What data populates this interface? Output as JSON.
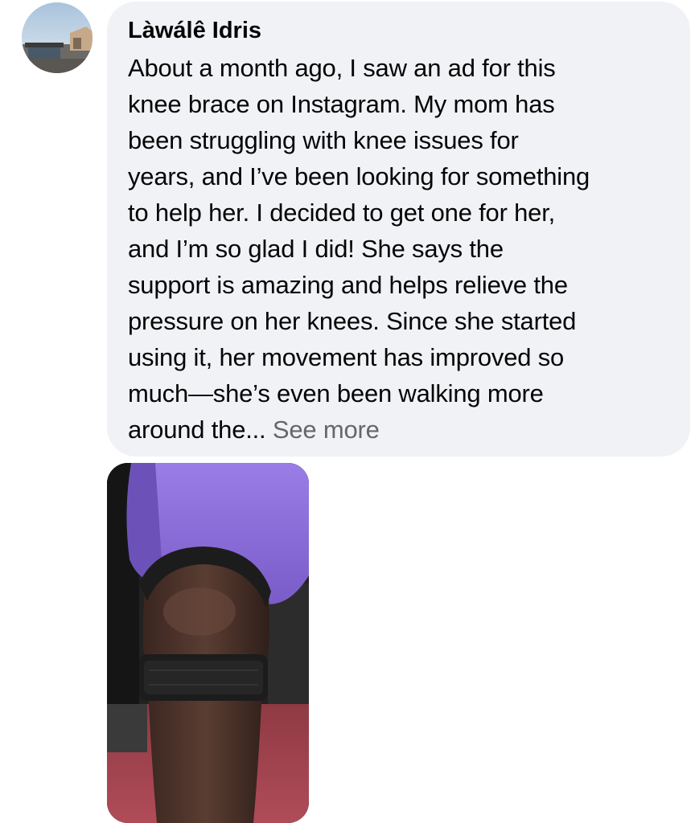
{
  "comment": {
    "author": "Làwálê Idris",
    "body": "About a month ago, I saw an ad for this\nknee brace on Instagram. My mom has\nbeen struggling with knee issues for\nyears, and I’ve been looking for something\nto help her. I decided to get one for her,\nand I’m so glad I did! She says the\nsupport is amazing and helps relieve the\npressure on her knees. Since she started\nusing it, her movement has improved so\nmuch—she’s even been walking more\naround the... ",
    "see_more_label": "See more"
  },
  "colors": {
    "bubble_bg": "#f0f2f5",
    "text": "#050505",
    "secondary_text": "#65676b",
    "shirt": "#8a6bd8",
    "strap": "#1c1c1c",
    "floor": "#a8434e"
  }
}
